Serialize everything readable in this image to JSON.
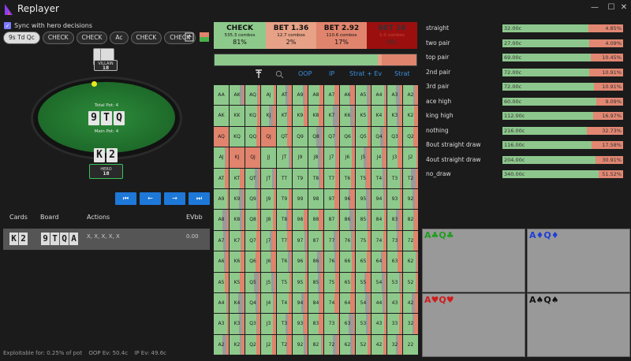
{
  "app": {
    "title": "Replayer"
  },
  "window_controls": {
    "minimize": "—",
    "maximize": "☐",
    "close": "✕"
  },
  "sync": {
    "label": "Sync with hero decisions",
    "checked": true
  },
  "pills": [
    "9s Td Qc",
    "CHECK",
    "CHECK",
    "Ac",
    "CHECK",
    "CHECK"
  ],
  "table": {
    "villain": {
      "label": "VILLAIN",
      "stack": "18"
    },
    "hero": {
      "label": "HERO",
      "stack": "18"
    },
    "total_pot": "Total Pot: 4",
    "main_pot": "Main Pot: 4",
    "board": [
      "9",
      "T",
      "Q"
    ],
    "hero_cards": [
      "K",
      "2"
    ]
  },
  "nav": {
    "first": "⏮",
    "prev": "←",
    "next": "→",
    "last": "⏭"
  },
  "history": {
    "headers": {
      "cards": "Cards",
      "board": "Board",
      "actions": "Actions",
      "ev": "EVbb"
    },
    "row": {
      "cards": [
        "K",
        "2"
      ],
      "board": [
        "9",
        "T",
        "Q",
        "A"
      ],
      "actions": "X, X, X, X, X",
      "ev": "0.00"
    }
  },
  "footer": {
    "exploitable": "Exploitable for: 0.25% of pot",
    "oop_ev": "OOP Ev: 50.4c",
    "ip_ev": "IP Ev: 49.6c"
  },
  "strategy": [
    {
      "action": "CHECK",
      "combos": "535.3 combos",
      "pct": "81%",
      "color": "#8ec98c"
    },
    {
      "action": "BET 1.36",
      "combos": "12.7 combos",
      "pct": "2%",
      "color": "#e6a186"
    },
    {
      "action": "BET 2.92",
      "combos": "110.6 combos",
      "pct": "17%",
      "color": "#e0846d"
    },
    {
      "action": "BET 18",
      "combos": "1.0 combos",
      "pct": "0%",
      "color": "#9c0f0f"
    }
  ],
  "tools": {
    "oop": "OOP",
    "ip": "IP",
    "strat_ev": "Strat + Ev",
    "strat": "Strat"
  },
  "ranks": [
    "A",
    "K",
    "Q",
    "J",
    "T",
    "9",
    "8",
    "7",
    "6",
    "5",
    "4",
    "3",
    "2"
  ],
  "grid_types": [
    "gmmmmmmmmmmmm",
    "ggmmmmmmmmmmm",
    "rgmrmgmmmmmmm",
    "mrrgmgmmmmmmm",
    "mmmmggmmmmmmm",
    "mmmmmggmmmmmm",
    "mmmmmmmmmmmmm",
    "mmmmmmmmmmmmm",
    "mmmmmmmmmmmmm",
    "mmmmmmmmmmmmm",
    "mmmmmmmmmmmmm",
    "mmmmmmmmmmmmm",
    "mmmmmmmmmmmmg"
  ],
  "hand_categories": [
    {
      "name": "straight",
      "combos": "32.00c",
      "pct": "4.85%",
      "green": 0.71,
      "red": 0.05
    },
    {
      "name": "two pair",
      "combos": "27.00c",
      "pct": "4.09%",
      "green": 0.72,
      "red": 0.04
    },
    {
      "name": "top pair",
      "combos": "69.00c",
      "pct": "10.45%",
      "green": 0.73,
      "red": 0.1
    },
    {
      "name": "2nd pair",
      "combos": "72.00c",
      "pct": "10.91%",
      "green": 0.72,
      "red": 0.11
    },
    {
      "name": "3rd pair",
      "combos": "72.00c",
      "pct": "10.91%",
      "green": 0.76,
      "red": 0.11
    },
    {
      "name": "ace high",
      "combos": "60.00c",
      "pct": "9.09%",
      "green": 0.78,
      "red": 0.09
    },
    {
      "name": "king high",
      "combos": "112.00c",
      "pct": "16.97%",
      "green": 0.75,
      "red": 0.17
    },
    {
      "name": "nothing",
      "combos": "216.00c",
      "pct": "32.73%",
      "green": 0.7,
      "red": 0.3
    },
    {
      "name": "8out straight draw",
      "combos": "116.00c",
      "pct": "17.58%",
      "green": 0.74,
      "red": 0.18
    },
    {
      "name": "4out straight draw",
      "combos": "204.00c",
      "pct": "30.91%",
      "green": 0.77,
      "red": 0.22
    },
    {
      "name": "no_draw",
      "combos": "340.00c",
      "pct": "51.52%",
      "green": 0.8,
      "red": 0.2
    }
  ],
  "suits": [
    {
      "text": "A♣Q♣",
      "color": "#1f9e1f"
    },
    {
      "text": "A♦Q♦",
      "color": "#1e3fd6"
    },
    {
      "text": "A♥Q♥",
      "color": "#d11b1b"
    },
    {
      "text": "A♠Q♠",
      "color": "#111111"
    }
  ],
  "colors": {
    "check": "#8ec98c",
    "bet": "#e0846d",
    "mixed_gray": "#9a9a9a",
    "accent": "#1e78d8"
  }
}
